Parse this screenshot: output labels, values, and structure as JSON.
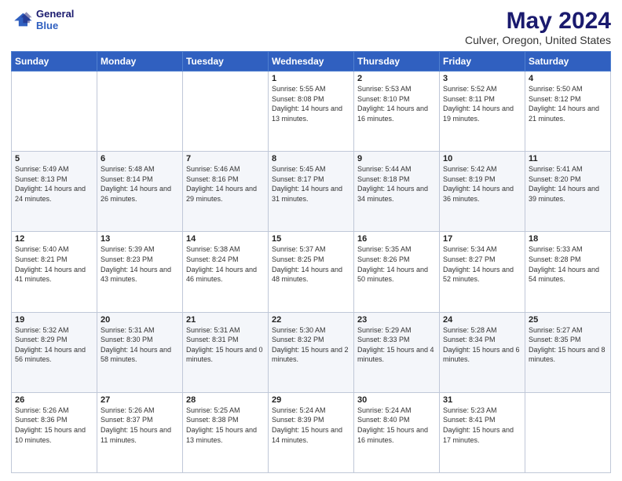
{
  "logo": {
    "line1": "General",
    "line2": "Blue"
  },
  "title": "May 2024",
  "subtitle": "Culver, Oregon, United States",
  "days_of_week": [
    "Sunday",
    "Monday",
    "Tuesday",
    "Wednesday",
    "Thursday",
    "Friday",
    "Saturday"
  ],
  "weeks": [
    [
      {
        "day": "",
        "sunrise": "",
        "sunset": "",
        "daylight": ""
      },
      {
        "day": "",
        "sunrise": "",
        "sunset": "",
        "daylight": ""
      },
      {
        "day": "",
        "sunrise": "",
        "sunset": "",
        "daylight": ""
      },
      {
        "day": "1",
        "sunrise": "Sunrise: 5:55 AM",
        "sunset": "Sunset: 8:08 PM",
        "daylight": "Daylight: 14 hours and 13 minutes."
      },
      {
        "day": "2",
        "sunrise": "Sunrise: 5:53 AM",
        "sunset": "Sunset: 8:10 PM",
        "daylight": "Daylight: 14 hours and 16 minutes."
      },
      {
        "day": "3",
        "sunrise": "Sunrise: 5:52 AM",
        "sunset": "Sunset: 8:11 PM",
        "daylight": "Daylight: 14 hours and 19 minutes."
      },
      {
        "day": "4",
        "sunrise": "Sunrise: 5:50 AM",
        "sunset": "Sunset: 8:12 PM",
        "daylight": "Daylight: 14 hours and 21 minutes."
      }
    ],
    [
      {
        "day": "5",
        "sunrise": "Sunrise: 5:49 AM",
        "sunset": "Sunset: 8:13 PM",
        "daylight": "Daylight: 14 hours and 24 minutes."
      },
      {
        "day": "6",
        "sunrise": "Sunrise: 5:48 AM",
        "sunset": "Sunset: 8:14 PM",
        "daylight": "Daylight: 14 hours and 26 minutes."
      },
      {
        "day": "7",
        "sunrise": "Sunrise: 5:46 AM",
        "sunset": "Sunset: 8:16 PM",
        "daylight": "Daylight: 14 hours and 29 minutes."
      },
      {
        "day": "8",
        "sunrise": "Sunrise: 5:45 AM",
        "sunset": "Sunset: 8:17 PM",
        "daylight": "Daylight: 14 hours and 31 minutes."
      },
      {
        "day": "9",
        "sunrise": "Sunrise: 5:44 AM",
        "sunset": "Sunset: 8:18 PM",
        "daylight": "Daylight: 14 hours and 34 minutes."
      },
      {
        "day": "10",
        "sunrise": "Sunrise: 5:42 AM",
        "sunset": "Sunset: 8:19 PM",
        "daylight": "Daylight: 14 hours and 36 minutes."
      },
      {
        "day": "11",
        "sunrise": "Sunrise: 5:41 AM",
        "sunset": "Sunset: 8:20 PM",
        "daylight": "Daylight: 14 hours and 39 minutes."
      }
    ],
    [
      {
        "day": "12",
        "sunrise": "Sunrise: 5:40 AM",
        "sunset": "Sunset: 8:21 PM",
        "daylight": "Daylight: 14 hours and 41 minutes."
      },
      {
        "day": "13",
        "sunrise": "Sunrise: 5:39 AM",
        "sunset": "Sunset: 8:23 PM",
        "daylight": "Daylight: 14 hours and 43 minutes."
      },
      {
        "day": "14",
        "sunrise": "Sunrise: 5:38 AM",
        "sunset": "Sunset: 8:24 PM",
        "daylight": "Daylight: 14 hours and 46 minutes."
      },
      {
        "day": "15",
        "sunrise": "Sunrise: 5:37 AM",
        "sunset": "Sunset: 8:25 PM",
        "daylight": "Daylight: 14 hours and 48 minutes."
      },
      {
        "day": "16",
        "sunrise": "Sunrise: 5:35 AM",
        "sunset": "Sunset: 8:26 PM",
        "daylight": "Daylight: 14 hours and 50 minutes."
      },
      {
        "day": "17",
        "sunrise": "Sunrise: 5:34 AM",
        "sunset": "Sunset: 8:27 PM",
        "daylight": "Daylight: 14 hours and 52 minutes."
      },
      {
        "day": "18",
        "sunrise": "Sunrise: 5:33 AM",
        "sunset": "Sunset: 8:28 PM",
        "daylight": "Daylight: 14 hours and 54 minutes."
      }
    ],
    [
      {
        "day": "19",
        "sunrise": "Sunrise: 5:32 AM",
        "sunset": "Sunset: 8:29 PM",
        "daylight": "Daylight: 14 hours and 56 minutes."
      },
      {
        "day": "20",
        "sunrise": "Sunrise: 5:31 AM",
        "sunset": "Sunset: 8:30 PM",
        "daylight": "Daylight: 14 hours and 58 minutes."
      },
      {
        "day": "21",
        "sunrise": "Sunrise: 5:31 AM",
        "sunset": "Sunset: 8:31 PM",
        "daylight": "Daylight: 15 hours and 0 minutes."
      },
      {
        "day": "22",
        "sunrise": "Sunrise: 5:30 AM",
        "sunset": "Sunset: 8:32 PM",
        "daylight": "Daylight: 15 hours and 2 minutes."
      },
      {
        "day": "23",
        "sunrise": "Sunrise: 5:29 AM",
        "sunset": "Sunset: 8:33 PM",
        "daylight": "Daylight: 15 hours and 4 minutes."
      },
      {
        "day": "24",
        "sunrise": "Sunrise: 5:28 AM",
        "sunset": "Sunset: 8:34 PM",
        "daylight": "Daylight: 15 hours and 6 minutes."
      },
      {
        "day": "25",
        "sunrise": "Sunrise: 5:27 AM",
        "sunset": "Sunset: 8:35 PM",
        "daylight": "Daylight: 15 hours and 8 minutes."
      }
    ],
    [
      {
        "day": "26",
        "sunrise": "Sunrise: 5:26 AM",
        "sunset": "Sunset: 8:36 PM",
        "daylight": "Daylight: 15 hours and 10 minutes."
      },
      {
        "day": "27",
        "sunrise": "Sunrise: 5:26 AM",
        "sunset": "Sunset: 8:37 PM",
        "daylight": "Daylight: 15 hours and 11 minutes."
      },
      {
        "day": "28",
        "sunrise": "Sunrise: 5:25 AM",
        "sunset": "Sunset: 8:38 PM",
        "daylight": "Daylight: 15 hours and 13 minutes."
      },
      {
        "day": "29",
        "sunrise": "Sunrise: 5:24 AM",
        "sunset": "Sunset: 8:39 PM",
        "daylight": "Daylight: 15 hours and 14 minutes."
      },
      {
        "day": "30",
        "sunrise": "Sunrise: 5:24 AM",
        "sunset": "Sunset: 8:40 PM",
        "daylight": "Daylight: 15 hours and 16 minutes."
      },
      {
        "day": "31",
        "sunrise": "Sunrise: 5:23 AM",
        "sunset": "Sunset: 8:41 PM",
        "daylight": "Daylight: 15 hours and 17 minutes."
      },
      {
        "day": "",
        "sunrise": "",
        "sunset": "",
        "daylight": ""
      }
    ]
  ]
}
